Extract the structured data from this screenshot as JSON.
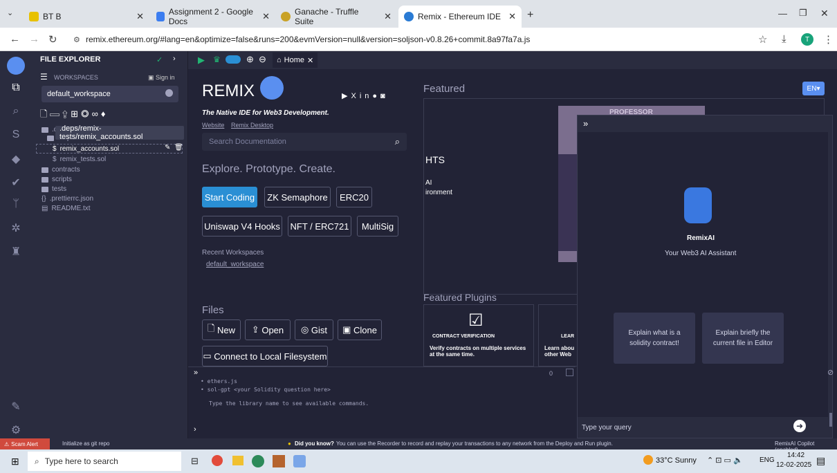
{
  "browser": {
    "tabs": [
      {
        "title": "BT B",
        "active": false
      },
      {
        "title": "Assignment 2 - Google Docs",
        "active": false
      },
      {
        "title": "Ganache - Truffle Suite",
        "active": false
      },
      {
        "title": "Remix - Ethereum IDE",
        "active": true
      }
    ],
    "url": "remix.ethereum.org/#lang=en&optimize=false&runs=200&evmVersion=null&version=soljson-v0.8.26+commit.8a97fa7a.js",
    "profile_initial": "T"
  },
  "sidebar": {
    "title": "FILE EXPLORER",
    "workspaces_label": "WORKSPACES",
    "sign_in": "Sign in",
    "workspace_selected": "default_workspace",
    "tooltip": ".deps/remix-tests/remix_accounts.sol",
    "tree": [
      ".d",
      ".deps",
      "remix_accounts.sol",
      "remix_tests.sol",
      "contracts",
      "scripts",
      "tests",
      ".prettierrc.json",
      "README.txt"
    ]
  },
  "editor": {
    "home_tab": "Home"
  },
  "home": {
    "brand": "REMIX",
    "tagline": "The Native IDE for Web3 Development.",
    "link_website": "Website",
    "link_desktop": "Remix Desktop",
    "search_placeholder": "Search Documentation",
    "explore": "Explore. Prototype. Create.",
    "buttons": [
      "Start Coding",
      "ZK Semaphore",
      "ERC20",
      "Uniswap V4 Hooks",
      "NFT / ERC721",
      "MultiSig"
    ],
    "recent_label": "Recent Workspaces",
    "recent_item": "default_workspace",
    "files_label": "Files",
    "file_buttons": [
      "New",
      "Open",
      "Gist",
      "Clone"
    ],
    "connect": "Connect to Local Filesystem"
  },
  "featured": {
    "title": "Featured",
    "lang": "EN",
    "partial_text1": "HTS",
    "partial_text2": "AI",
    "partial_text3": "ironment",
    "poster_text": "PROFESSOR",
    "plugins_title": "Featured Plugins",
    "plugin1_title": "CONTRACT VERIFICATION",
    "plugin1_desc": "Verify contracts on multiple services at the same time.",
    "plugin2_title": "LEAR",
    "plugin2_desc": "Learn abou other Web"
  },
  "ai": {
    "name": "RemixAI",
    "subtitle": "Your Web3 AI Assistant",
    "suggestion1": "Explain what is a solidity contract!",
    "suggestion2": "Explain briefly the current file in Editor",
    "input_placeholder": "Type your query"
  },
  "terminal": {
    "line1": "• ethers.js",
    "line2": "• sol-gpt <your Solidity question here>",
    "line3": "Type the library name to see available commands.",
    "counter": "0"
  },
  "status": {
    "scam": "Scam Alert",
    "git": "Initialize as git repo",
    "tip_bold": "Did you know?",
    "tip": "You can use the Recorder to record and replay your transactions to any network from the Deploy and Run plugin.",
    "copilot": "RemixAI Copilot (enabled)"
  },
  "taskbar": {
    "search": "Type here to search",
    "weather": "33°C  Sunny",
    "lang": "ENG",
    "time": "14:42",
    "date": "12-02-2025"
  }
}
